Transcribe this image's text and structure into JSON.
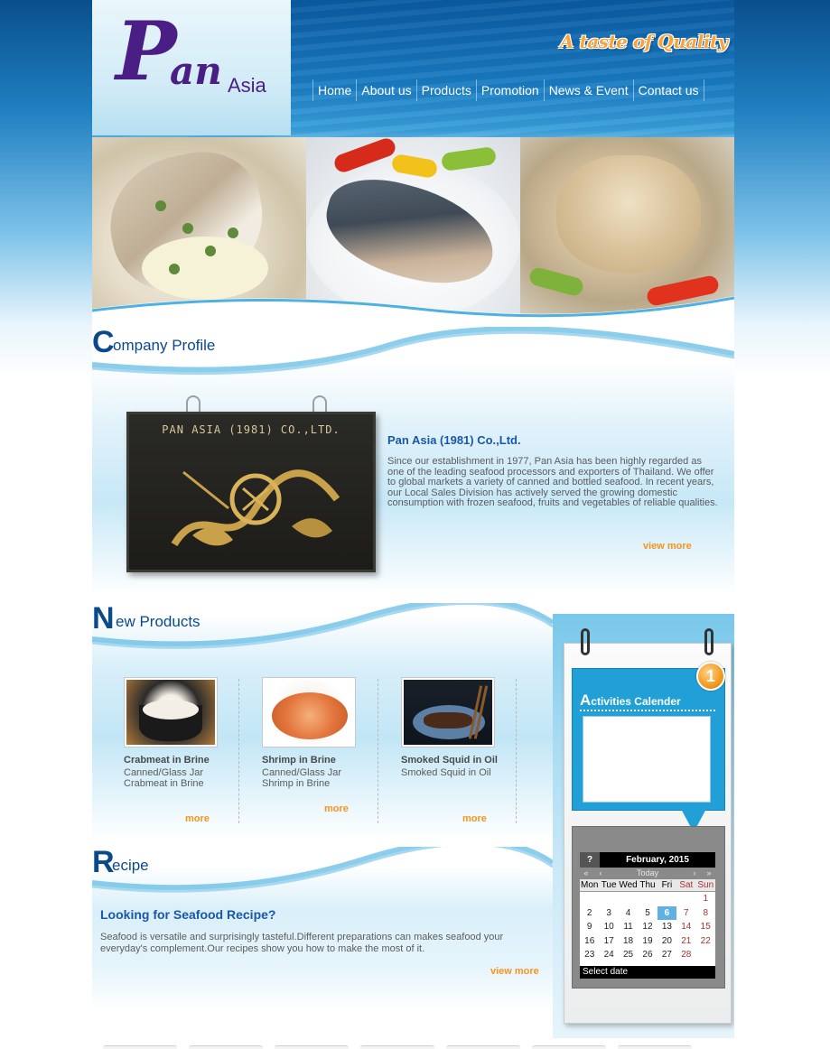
{
  "header": {
    "logo_text": "PanAsia",
    "tagline": "A taste of Quality",
    "nav": [
      "Home",
      "About us",
      "Products",
      "Promotion",
      "News & Event",
      "Contact us"
    ]
  },
  "company_profile": {
    "heading_cap": "C",
    "heading_rest": "ompany Profile",
    "plaque_text": "PAN ASIA (1981) CO.,LTD.",
    "title": "Pan Asia (1981) Co.,Ltd.",
    "body": "Since our establishment in 1977, Pan Asia has been highly regarded as one of the leading seafood processors and exporters of Thailand. We offer to global markets a variety of canned and bottled seafood. In recent years, our Local Sales Division has actively served the growing domestic consumption with frozen seafood, fruits and vegetables of reliable qualities.",
    "more": "view more"
  },
  "new_products": {
    "heading_cap": "N",
    "heading_rest": "ew Products",
    "items": [
      {
        "name": "Crabmeat in Brine",
        "desc": "Canned/Glass Jar Crabmeat in Brine",
        "more": "more"
      },
      {
        "name": "Shrimp in Brine",
        "desc": "Canned/Glass Jar Shrimp in Brine",
        "more": "more"
      },
      {
        "name": "Smoked Squid in Oil",
        "desc": "Smoked Squid in Oil",
        "more": "more"
      }
    ]
  },
  "recipe": {
    "heading_cap": "R",
    "heading_rest": "ecipe",
    "title": "Looking for Seafood Recipe?",
    "body": "Seafood is versatile and surprisingly tasteful.Different preparations can makes seafood your everyday's complement.Our recipes show you how to make the most of it.",
    "more": "view more"
  },
  "activities": {
    "title_cap": "A",
    "title_rest": "ctivities Calender",
    "badge": "1"
  },
  "calendar": {
    "help": "?",
    "month": "February, 2015",
    "nav": [
      "«",
      "‹",
      "Today",
      "›",
      "»"
    ],
    "days": [
      "Mon",
      "Tue",
      "Wed",
      "Thu",
      "Fri",
      "Sat",
      "Sun"
    ],
    "weeks": [
      [
        "",
        "",
        "",
        "",
        "",
        "",
        "1"
      ],
      [
        "2",
        "3",
        "4",
        "5",
        "6",
        "7",
        "8"
      ],
      [
        "9",
        "10",
        "11",
        "12",
        "13",
        "14",
        "15"
      ],
      [
        "16",
        "17",
        "18",
        "19",
        "20",
        "21",
        "22"
      ],
      [
        "23",
        "24",
        "25",
        "26",
        "27",
        "28",
        ""
      ]
    ],
    "today": "6",
    "footer": "Select date"
  },
  "colors": {
    "brand_purple": "#4a1e85",
    "heading_blue": "#0b4a8a",
    "link_orange": "#f7941d",
    "calendar_blue": "#21a0d8"
  }
}
